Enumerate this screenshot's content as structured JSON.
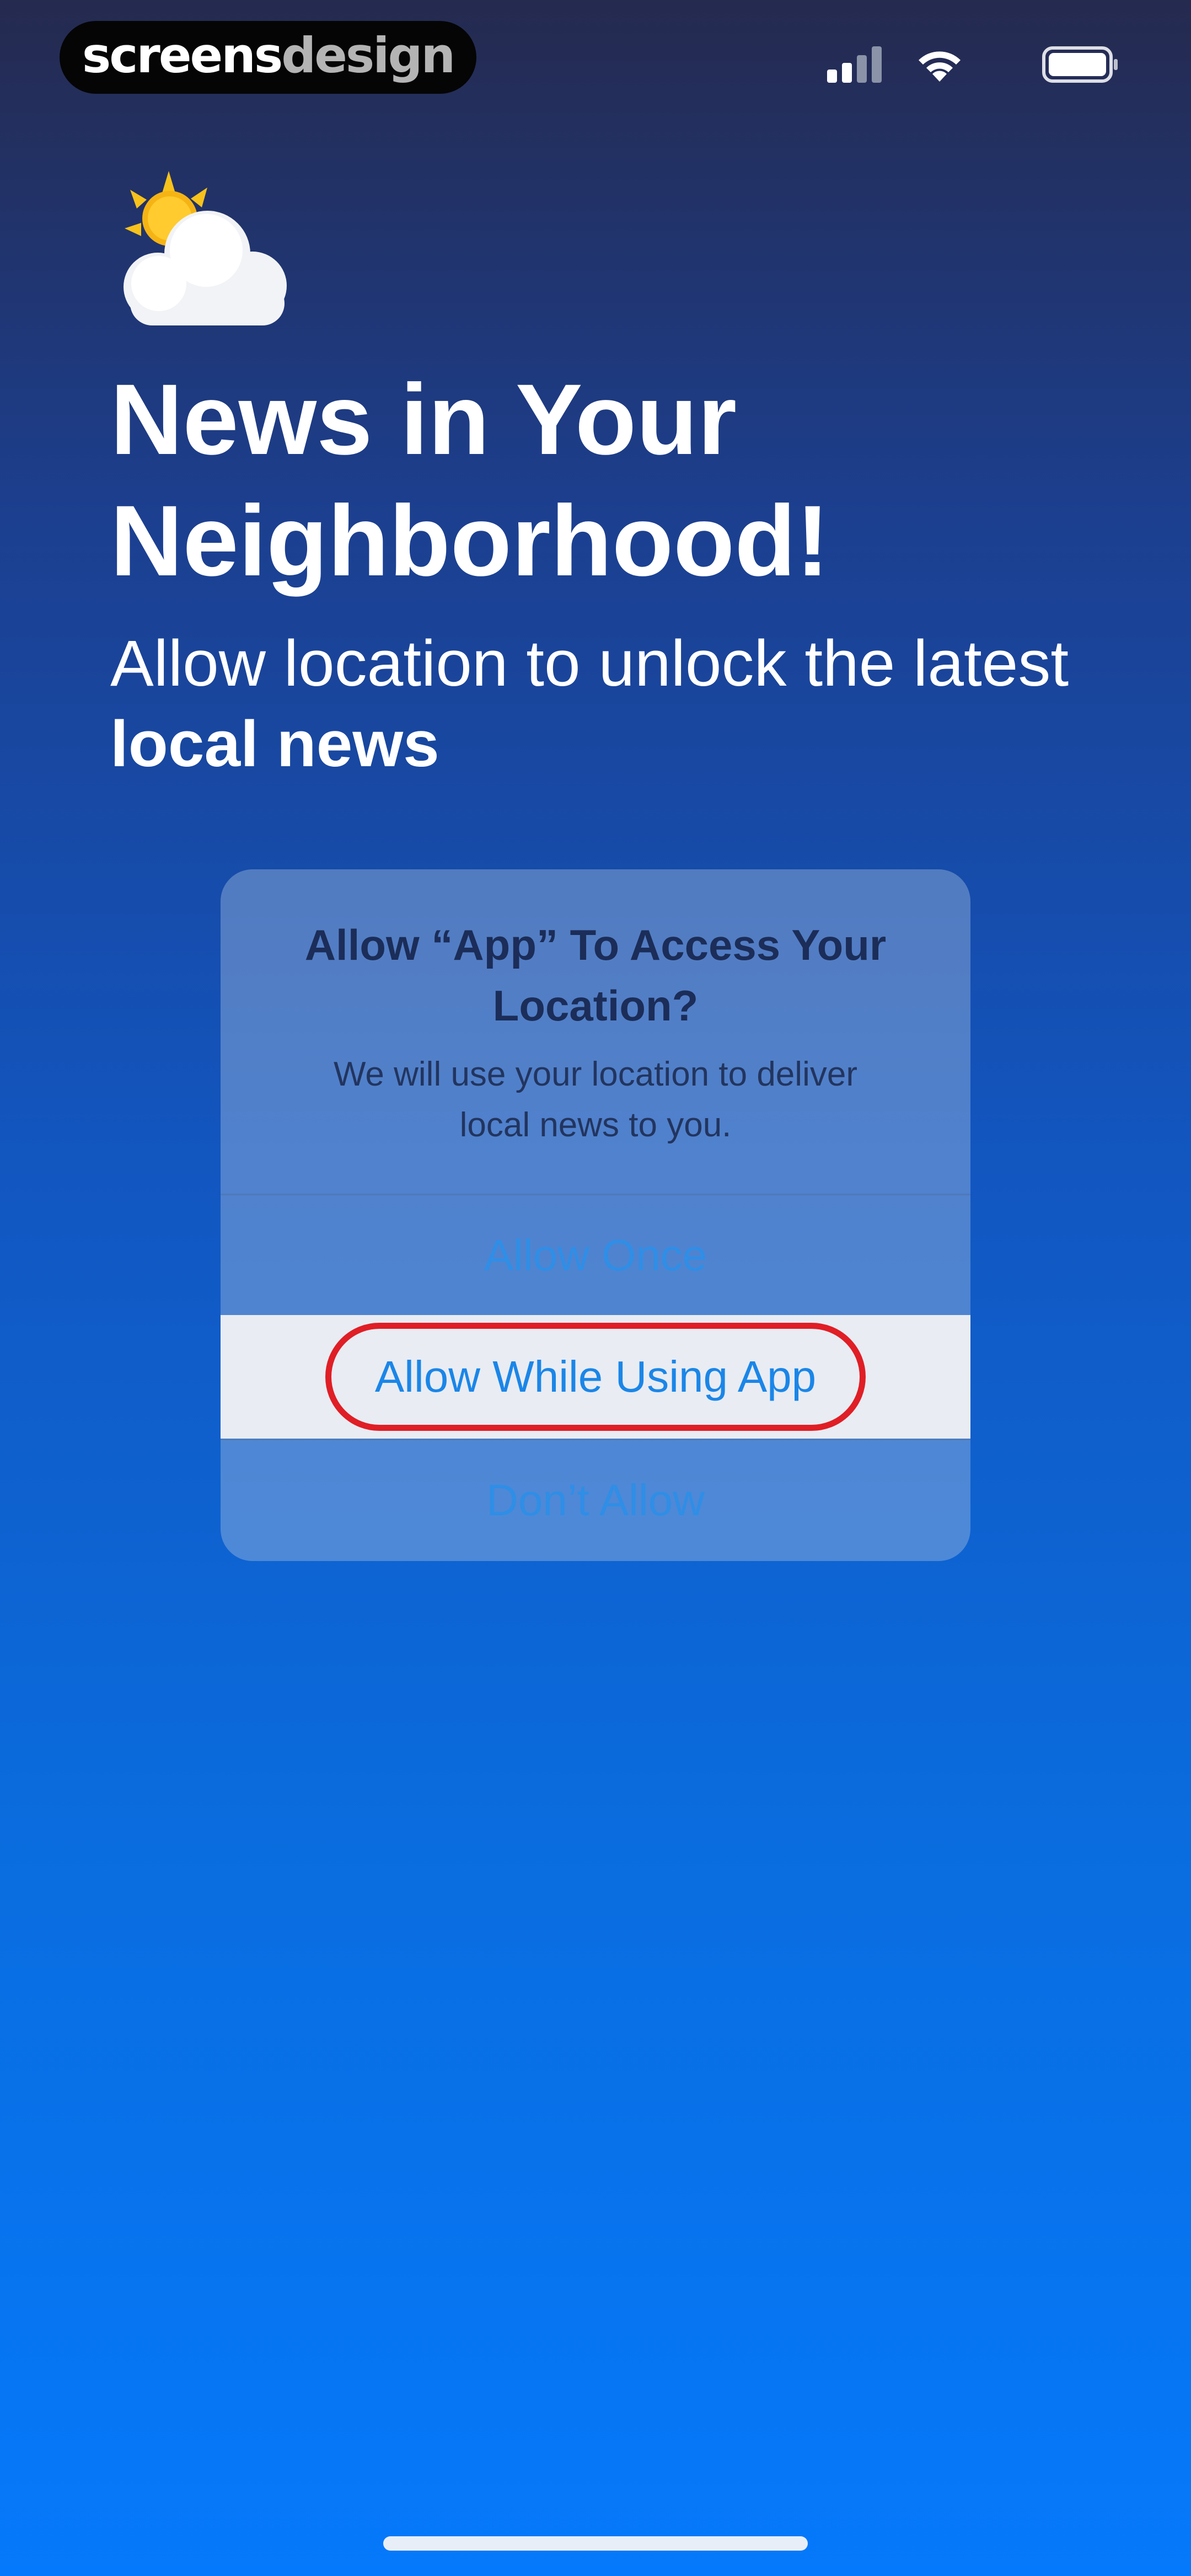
{
  "watermark": {
    "part1": "screens",
    "part2": "design"
  },
  "status_bar": {
    "icons": [
      "signal-bars-icon",
      "wifi-icon",
      "battery-icon"
    ]
  },
  "onboarding": {
    "icon": "sun-behind-cloud-icon",
    "title_line1": "News in Your",
    "title_line2": "Neighborhood!",
    "subtitle_regular": "Allow location to unlock the latest",
    "subtitle_bold": "local news"
  },
  "alert": {
    "title_line1": "Allow “App” To Access Your",
    "title_line2": "Location?",
    "message_line1": "We will use your location to deliver",
    "message_line2": "local news to you.",
    "buttons": [
      {
        "label": "Allow Once"
      },
      {
        "label": "Allow While Using App",
        "highlighted": true
      },
      {
        "label": "Don’t Allow"
      }
    ]
  },
  "colors": {
    "background_top": "#252a4f",
    "background_bottom": "#0579fb",
    "alert_button_text": "#2f8ee6",
    "highlight_ring": "#e01e25"
  }
}
